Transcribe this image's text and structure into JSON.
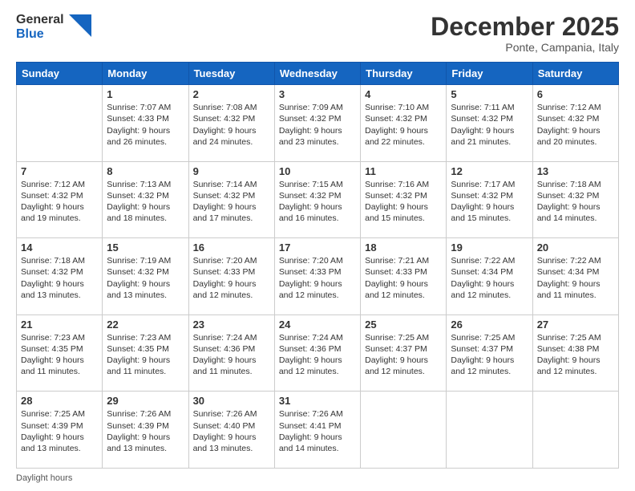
{
  "header": {
    "logo_general": "General",
    "logo_blue": "Blue",
    "month_title": "December 2025",
    "location": "Ponte, Campania, Italy"
  },
  "columns": [
    "Sunday",
    "Monday",
    "Tuesday",
    "Wednesday",
    "Thursday",
    "Friday",
    "Saturday"
  ],
  "footer": "Daylight hours",
  "weeks": [
    [
      {
        "day": "",
        "sunrise": "",
        "sunset": "",
        "daylight": ""
      },
      {
        "day": "1",
        "sunrise": "Sunrise: 7:07 AM",
        "sunset": "Sunset: 4:33 PM",
        "daylight": "Daylight: 9 hours and 26 minutes."
      },
      {
        "day": "2",
        "sunrise": "Sunrise: 7:08 AM",
        "sunset": "Sunset: 4:32 PM",
        "daylight": "Daylight: 9 hours and 24 minutes."
      },
      {
        "day": "3",
        "sunrise": "Sunrise: 7:09 AM",
        "sunset": "Sunset: 4:32 PM",
        "daylight": "Daylight: 9 hours and 23 minutes."
      },
      {
        "day": "4",
        "sunrise": "Sunrise: 7:10 AM",
        "sunset": "Sunset: 4:32 PM",
        "daylight": "Daylight: 9 hours and 22 minutes."
      },
      {
        "day": "5",
        "sunrise": "Sunrise: 7:11 AM",
        "sunset": "Sunset: 4:32 PM",
        "daylight": "Daylight: 9 hours and 21 minutes."
      },
      {
        "day": "6",
        "sunrise": "Sunrise: 7:12 AM",
        "sunset": "Sunset: 4:32 PM",
        "daylight": "Daylight: 9 hours and 20 minutes."
      }
    ],
    [
      {
        "day": "7",
        "sunrise": "Sunrise: 7:12 AM",
        "sunset": "Sunset: 4:32 PM",
        "daylight": "Daylight: 9 hours and 19 minutes."
      },
      {
        "day": "8",
        "sunrise": "Sunrise: 7:13 AM",
        "sunset": "Sunset: 4:32 PM",
        "daylight": "Daylight: 9 hours and 18 minutes."
      },
      {
        "day": "9",
        "sunrise": "Sunrise: 7:14 AM",
        "sunset": "Sunset: 4:32 PM",
        "daylight": "Daylight: 9 hours and 17 minutes."
      },
      {
        "day": "10",
        "sunrise": "Sunrise: 7:15 AM",
        "sunset": "Sunset: 4:32 PM",
        "daylight": "Daylight: 9 hours and 16 minutes."
      },
      {
        "day": "11",
        "sunrise": "Sunrise: 7:16 AM",
        "sunset": "Sunset: 4:32 PM",
        "daylight": "Daylight: 9 hours and 15 minutes."
      },
      {
        "day": "12",
        "sunrise": "Sunrise: 7:17 AM",
        "sunset": "Sunset: 4:32 PM",
        "daylight": "Daylight: 9 hours and 15 minutes."
      },
      {
        "day": "13",
        "sunrise": "Sunrise: 7:18 AM",
        "sunset": "Sunset: 4:32 PM",
        "daylight": "Daylight: 9 hours and 14 minutes."
      }
    ],
    [
      {
        "day": "14",
        "sunrise": "Sunrise: 7:18 AM",
        "sunset": "Sunset: 4:32 PM",
        "daylight": "Daylight: 9 hours and 13 minutes."
      },
      {
        "day": "15",
        "sunrise": "Sunrise: 7:19 AM",
        "sunset": "Sunset: 4:32 PM",
        "daylight": "Daylight: 9 hours and 13 minutes."
      },
      {
        "day": "16",
        "sunrise": "Sunrise: 7:20 AM",
        "sunset": "Sunset: 4:33 PM",
        "daylight": "Daylight: 9 hours and 12 minutes."
      },
      {
        "day": "17",
        "sunrise": "Sunrise: 7:20 AM",
        "sunset": "Sunset: 4:33 PM",
        "daylight": "Daylight: 9 hours and 12 minutes."
      },
      {
        "day": "18",
        "sunrise": "Sunrise: 7:21 AM",
        "sunset": "Sunset: 4:33 PM",
        "daylight": "Daylight: 9 hours and 12 minutes."
      },
      {
        "day": "19",
        "sunrise": "Sunrise: 7:22 AM",
        "sunset": "Sunset: 4:34 PM",
        "daylight": "Daylight: 9 hours and 12 minutes."
      },
      {
        "day": "20",
        "sunrise": "Sunrise: 7:22 AM",
        "sunset": "Sunset: 4:34 PM",
        "daylight": "Daylight: 9 hours and 11 minutes."
      }
    ],
    [
      {
        "day": "21",
        "sunrise": "Sunrise: 7:23 AM",
        "sunset": "Sunset: 4:35 PM",
        "daylight": "Daylight: 9 hours and 11 minutes."
      },
      {
        "day": "22",
        "sunrise": "Sunrise: 7:23 AM",
        "sunset": "Sunset: 4:35 PM",
        "daylight": "Daylight: 9 hours and 11 minutes."
      },
      {
        "day": "23",
        "sunrise": "Sunrise: 7:24 AM",
        "sunset": "Sunset: 4:36 PM",
        "daylight": "Daylight: 9 hours and 11 minutes."
      },
      {
        "day": "24",
        "sunrise": "Sunrise: 7:24 AM",
        "sunset": "Sunset: 4:36 PM",
        "daylight": "Daylight: 9 hours and 12 minutes."
      },
      {
        "day": "25",
        "sunrise": "Sunrise: 7:25 AM",
        "sunset": "Sunset: 4:37 PM",
        "daylight": "Daylight: 9 hours and 12 minutes."
      },
      {
        "day": "26",
        "sunrise": "Sunrise: 7:25 AM",
        "sunset": "Sunset: 4:37 PM",
        "daylight": "Daylight: 9 hours and 12 minutes."
      },
      {
        "day": "27",
        "sunrise": "Sunrise: 7:25 AM",
        "sunset": "Sunset: 4:38 PM",
        "daylight": "Daylight: 9 hours and 12 minutes."
      }
    ],
    [
      {
        "day": "28",
        "sunrise": "Sunrise: 7:25 AM",
        "sunset": "Sunset: 4:39 PM",
        "daylight": "Daylight: 9 hours and 13 minutes."
      },
      {
        "day": "29",
        "sunrise": "Sunrise: 7:26 AM",
        "sunset": "Sunset: 4:39 PM",
        "daylight": "Daylight: 9 hours and 13 minutes."
      },
      {
        "day": "30",
        "sunrise": "Sunrise: 7:26 AM",
        "sunset": "Sunset: 4:40 PM",
        "daylight": "Daylight: 9 hours and 13 minutes."
      },
      {
        "day": "31",
        "sunrise": "Sunrise: 7:26 AM",
        "sunset": "Sunset: 4:41 PM",
        "daylight": "Daylight: 9 hours and 14 minutes."
      },
      {
        "day": "",
        "sunrise": "",
        "sunset": "",
        "daylight": ""
      },
      {
        "day": "",
        "sunrise": "",
        "sunset": "",
        "daylight": ""
      },
      {
        "day": "",
        "sunrise": "",
        "sunset": "",
        "daylight": ""
      }
    ]
  ]
}
